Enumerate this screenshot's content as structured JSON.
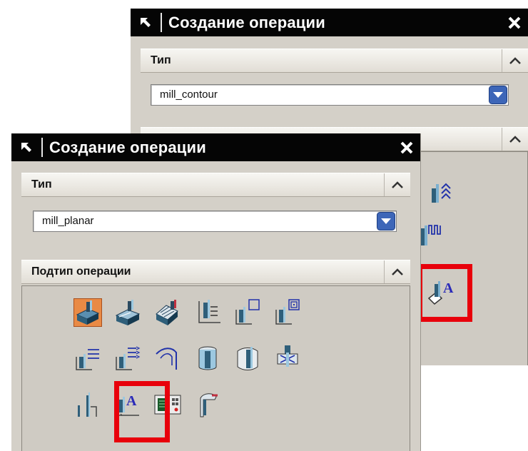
{
  "back_dialog": {
    "title": "Создание операции",
    "type_section": {
      "label": "Тип",
      "selected": "mill_contour"
    }
  },
  "front_dialog": {
    "title": "Создание операции",
    "type_section": {
      "label": "Тип",
      "selected": "mill_planar"
    },
    "subtype_section": {
      "label": "Подтип операции",
      "selected_index": 0,
      "highlighted_index": 13
    }
  },
  "colors": {
    "highlight": "#e8000b",
    "titlebar": "#050505",
    "selected_icon_bg": "#e98a45"
  }
}
